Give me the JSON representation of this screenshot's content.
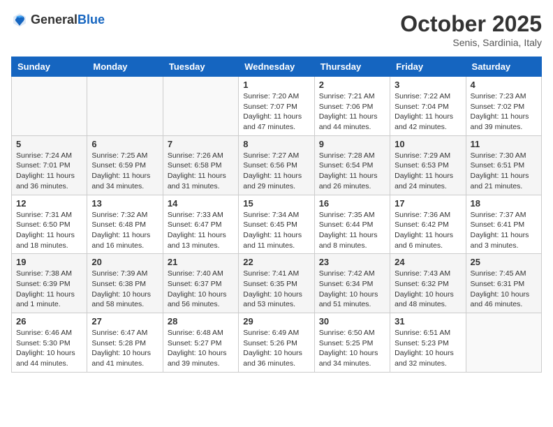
{
  "header": {
    "logo_general": "General",
    "logo_blue": "Blue",
    "month_title": "October 2025",
    "subtitle": "Senis, Sardinia, Italy"
  },
  "days_of_week": [
    "Sunday",
    "Monday",
    "Tuesday",
    "Wednesday",
    "Thursday",
    "Friday",
    "Saturday"
  ],
  "weeks": [
    {
      "alt": false,
      "days": [
        {
          "num": "",
          "info": ""
        },
        {
          "num": "",
          "info": ""
        },
        {
          "num": "",
          "info": ""
        },
        {
          "num": "1",
          "info": "Sunrise: 7:20 AM\nSunset: 7:07 PM\nDaylight: 11 hours and 47 minutes."
        },
        {
          "num": "2",
          "info": "Sunrise: 7:21 AM\nSunset: 7:06 PM\nDaylight: 11 hours and 44 minutes."
        },
        {
          "num": "3",
          "info": "Sunrise: 7:22 AM\nSunset: 7:04 PM\nDaylight: 11 hours and 42 minutes."
        },
        {
          "num": "4",
          "info": "Sunrise: 7:23 AM\nSunset: 7:02 PM\nDaylight: 11 hours and 39 minutes."
        }
      ]
    },
    {
      "alt": true,
      "days": [
        {
          "num": "5",
          "info": "Sunrise: 7:24 AM\nSunset: 7:01 PM\nDaylight: 11 hours and 36 minutes."
        },
        {
          "num": "6",
          "info": "Sunrise: 7:25 AM\nSunset: 6:59 PM\nDaylight: 11 hours and 34 minutes."
        },
        {
          "num": "7",
          "info": "Sunrise: 7:26 AM\nSunset: 6:58 PM\nDaylight: 11 hours and 31 minutes."
        },
        {
          "num": "8",
          "info": "Sunrise: 7:27 AM\nSunset: 6:56 PM\nDaylight: 11 hours and 29 minutes."
        },
        {
          "num": "9",
          "info": "Sunrise: 7:28 AM\nSunset: 6:54 PM\nDaylight: 11 hours and 26 minutes."
        },
        {
          "num": "10",
          "info": "Sunrise: 7:29 AM\nSunset: 6:53 PM\nDaylight: 11 hours and 24 minutes."
        },
        {
          "num": "11",
          "info": "Sunrise: 7:30 AM\nSunset: 6:51 PM\nDaylight: 11 hours and 21 minutes."
        }
      ]
    },
    {
      "alt": false,
      "days": [
        {
          "num": "12",
          "info": "Sunrise: 7:31 AM\nSunset: 6:50 PM\nDaylight: 11 hours and 18 minutes."
        },
        {
          "num": "13",
          "info": "Sunrise: 7:32 AM\nSunset: 6:48 PM\nDaylight: 11 hours and 16 minutes."
        },
        {
          "num": "14",
          "info": "Sunrise: 7:33 AM\nSunset: 6:47 PM\nDaylight: 11 hours and 13 minutes."
        },
        {
          "num": "15",
          "info": "Sunrise: 7:34 AM\nSunset: 6:45 PM\nDaylight: 11 hours and 11 minutes."
        },
        {
          "num": "16",
          "info": "Sunrise: 7:35 AM\nSunset: 6:44 PM\nDaylight: 11 hours and 8 minutes."
        },
        {
          "num": "17",
          "info": "Sunrise: 7:36 AM\nSunset: 6:42 PM\nDaylight: 11 hours and 6 minutes."
        },
        {
          "num": "18",
          "info": "Sunrise: 7:37 AM\nSunset: 6:41 PM\nDaylight: 11 hours and 3 minutes."
        }
      ]
    },
    {
      "alt": true,
      "days": [
        {
          "num": "19",
          "info": "Sunrise: 7:38 AM\nSunset: 6:39 PM\nDaylight: 11 hours and 1 minute."
        },
        {
          "num": "20",
          "info": "Sunrise: 7:39 AM\nSunset: 6:38 PM\nDaylight: 10 hours and 58 minutes."
        },
        {
          "num": "21",
          "info": "Sunrise: 7:40 AM\nSunset: 6:37 PM\nDaylight: 10 hours and 56 minutes."
        },
        {
          "num": "22",
          "info": "Sunrise: 7:41 AM\nSunset: 6:35 PM\nDaylight: 10 hours and 53 minutes."
        },
        {
          "num": "23",
          "info": "Sunrise: 7:42 AM\nSunset: 6:34 PM\nDaylight: 10 hours and 51 minutes."
        },
        {
          "num": "24",
          "info": "Sunrise: 7:43 AM\nSunset: 6:32 PM\nDaylight: 10 hours and 48 minutes."
        },
        {
          "num": "25",
          "info": "Sunrise: 7:45 AM\nSunset: 6:31 PM\nDaylight: 10 hours and 46 minutes."
        }
      ]
    },
    {
      "alt": false,
      "days": [
        {
          "num": "26",
          "info": "Sunrise: 6:46 AM\nSunset: 5:30 PM\nDaylight: 10 hours and 44 minutes."
        },
        {
          "num": "27",
          "info": "Sunrise: 6:47 AM\nSunset: 5:28 PM\nDaylight: 10 hours and 41 minutes."
        },
        {
          "num": "28",
          "info": "Sunrise: 6:48 AM\nSunset: 5:27 PM\nDaylight: 10 hours and 39 minutes."
        },
        {
          "num": "29",
          "info": "Sunrise: 6:49 AM\nSunset: 5:26 PM\nDaylight: 10 hours and 36 minutes."
        },
        {
          "num": "30",
          "info": "Sunrise: 6:50 AM\nSunset: 5:25 PM\nDaylight: 10 hours and 34 minutes."
        },
        {
          "num": "31",
          "info": "Sunrise: 6:51 AM\nSunset: 5:23 PM\nDaylight: 10 hours and 32 minutes."
        },
        {
          "num": "",
          "info": ""
        }
      ]
    }
  ]
}
